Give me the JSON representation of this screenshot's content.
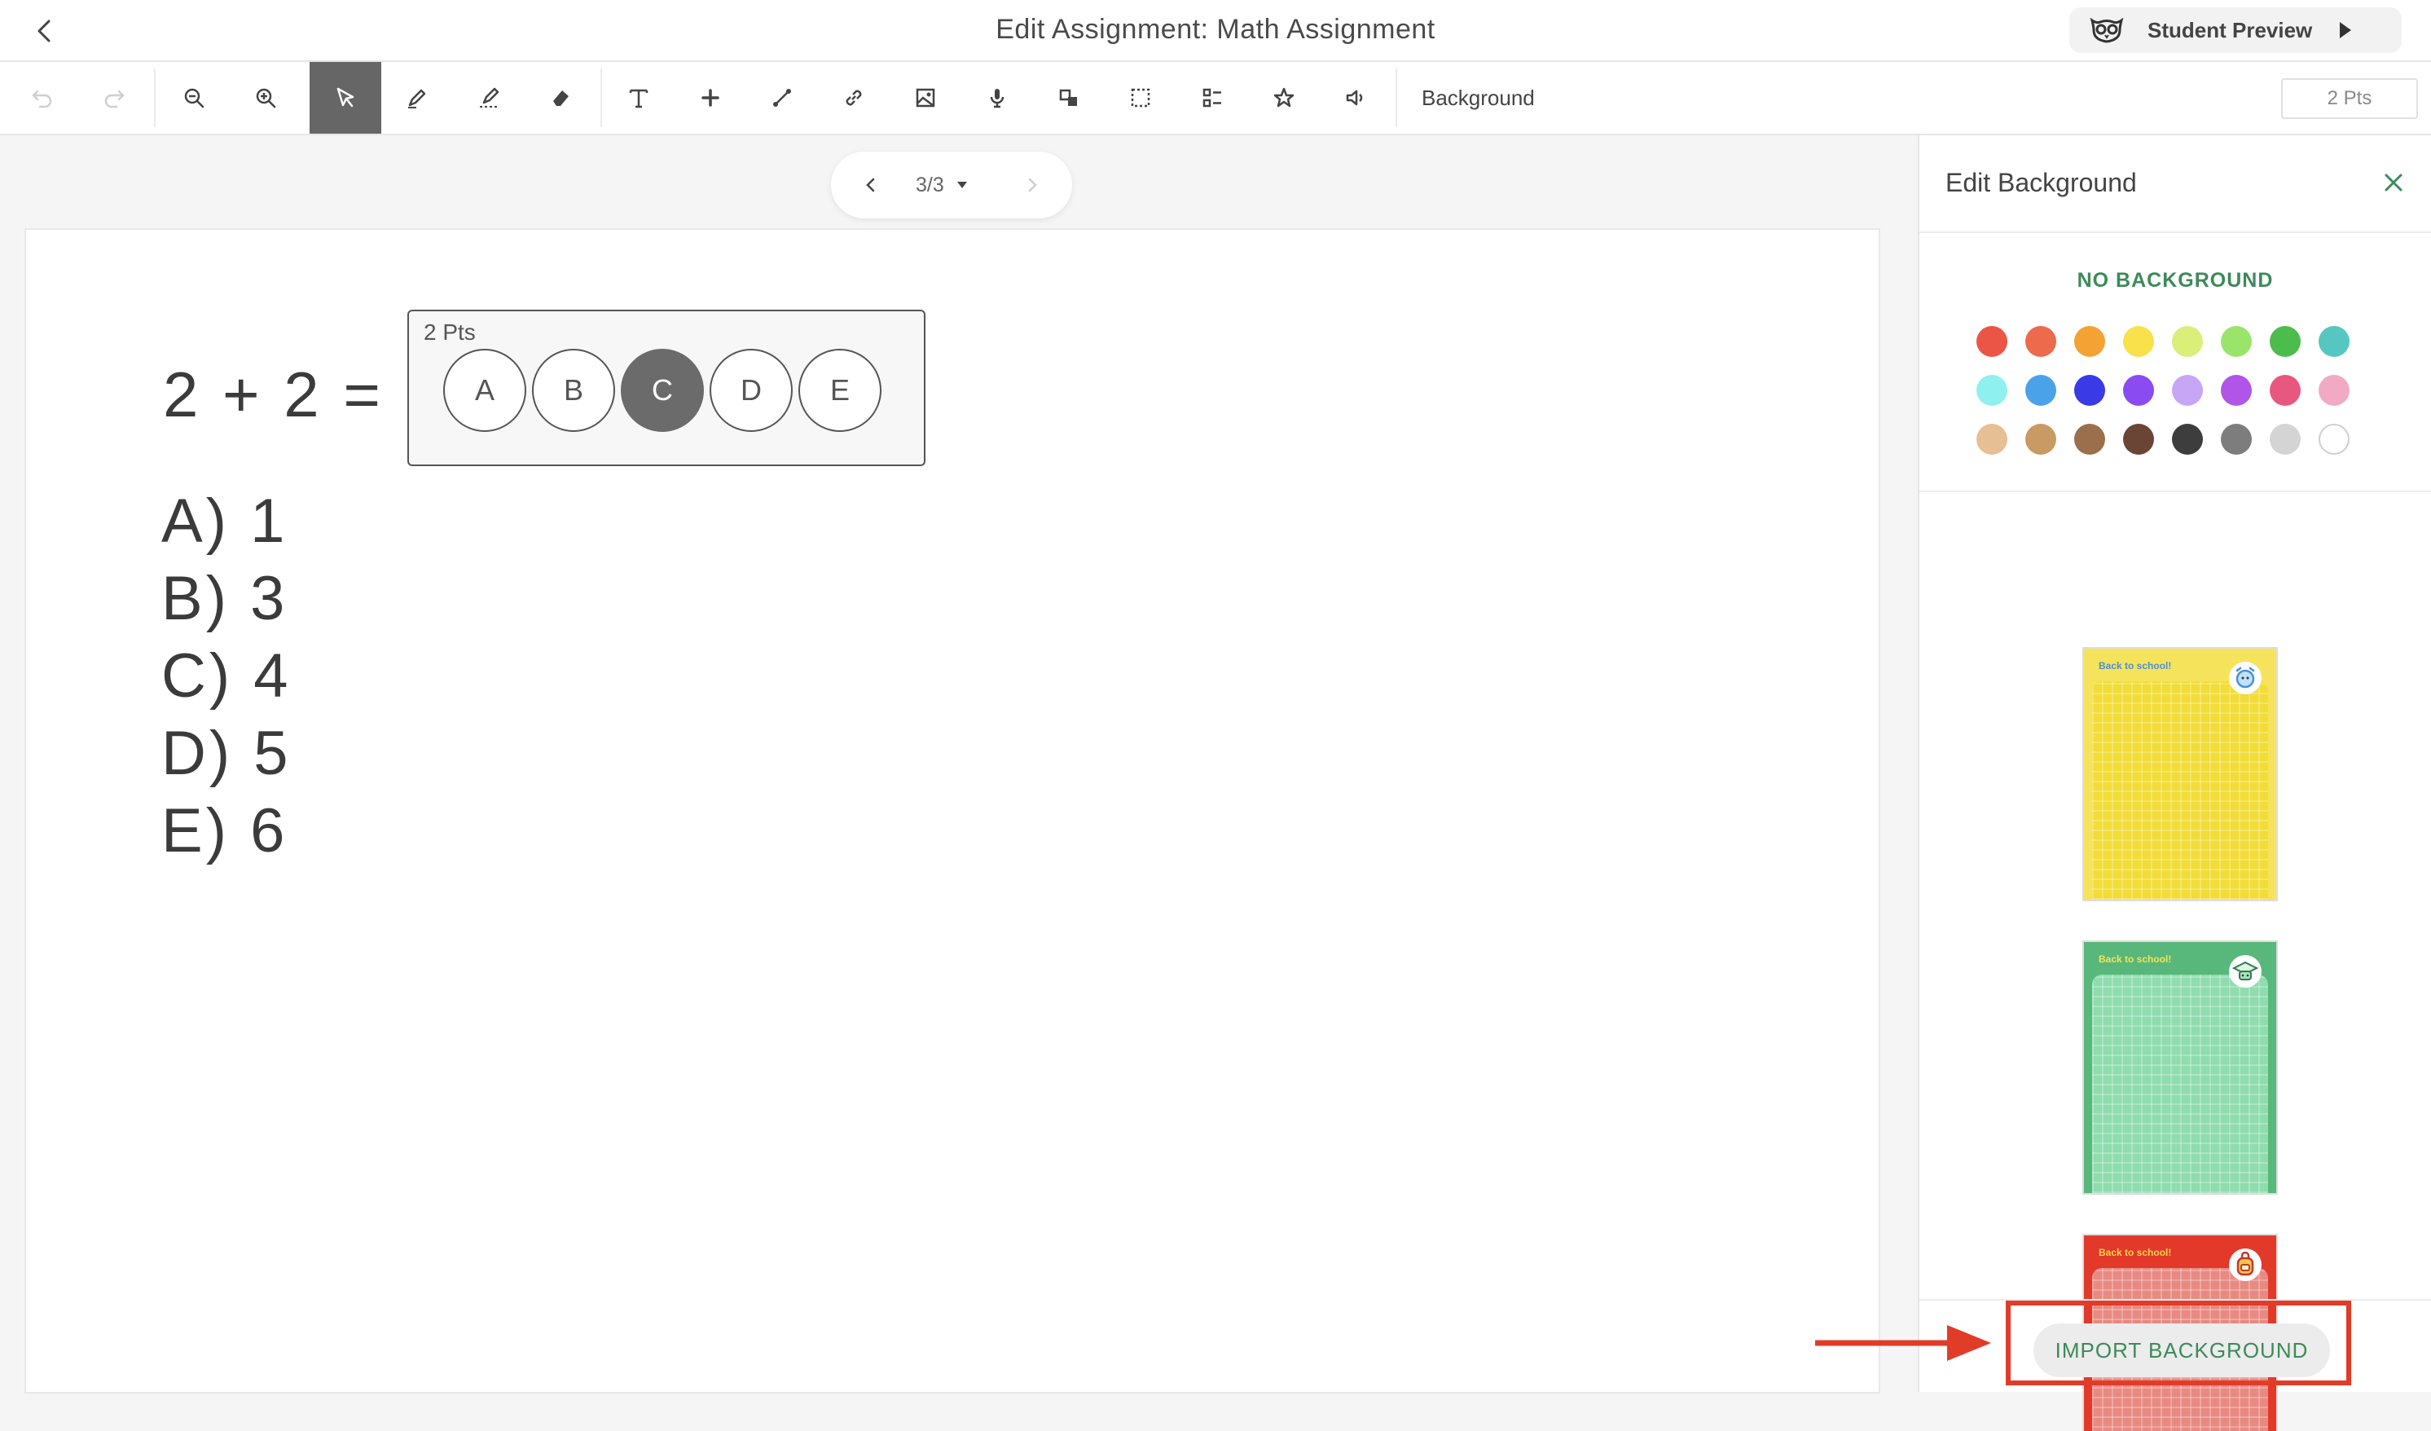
{
  "header": {
    "title": "Edit Assignment: Math Assignment",
    "student_preview_label": "Student Preview"
  },
  "toolbar": {
    "tools": [
      "undo-icon",
      "redo-icon",
      "zoom-out-icon",
      "zoom-in-icon",
      "select-icon",
      "pen-icon",
      "highlighter-icon",
      "eraser-icon",
      "text-icon",
      "plus-icon",
      "line-icon",
      "link-icon",
      "image-icon",
      "microphone-icon",
      "shapes-icon",
      "marquee-icon",
      "answer-bubble-icon",
      "star-icon",
      "speaker-icon"
    ],
    "active_tool": "select-icon",
    "background_label": "Background",
    "points_value": "2 Pts"
  },
  "pager": {
    "current": "3/3"
  },
  "worksheet": {
    "equation": "2 + 2 =",
    "answer_box": {
      "points": "2 Pts",
      "choices": [
        "A",
        "B",
        "C",
        "D",
        "E"
      ],
      "selected": "C"
    },
    "options": [
      "A) 1",
      "B) 3",
      "C) 4",
      "D) 5",
      "E) 6"
    ]
  },
  "panel": {
    "title": "Edit Background",
    "no_background_label": "NO BACKGROUND",
    "swatch_colors": [
      [
        "#eb5546",
        "#ed6a4c",
        "#f4a233",
        "#f8e14a",
        "#d9ef7a",
        "#9be46c",
        "#4cbd4c",
        "#55c6c0"
      ],
      [
        "#8ef0ef",
        "#4aa3e8",
        "#3a3ae6",
        "#8a4cf0",
        "#c7a6f5",
        "#b055e8",
        "#e8577f",
        "#f2a9c4"
      ],
      [
        "#e6bf94",
        "#c99a63",
        "#9b6f4b",
        "#6a4535",
        "#3d3d3d",
        "#7d7d7d",
        "#d4d4d4",
        "#ffffff"
      ]
    ],
    "templates": [
      {
        "text": "Back to school!",
        "bg": "#f6e35c",
        "sheet": "#f2dc38",
        "text_color": "#4a8fd8"
      },
      {
        "text": "Back to school!",
        "bg": "#58b77a",
        "sheet": "#8fdcae",
        "text_color": "#f4e35a"
      },
      {
        "text": "Back to school!",
        "bg": "#e2392a",
        "sheet": "#e88a82",
        "text_color": "#f6d44a"
      }
    ],
    "import_label": "IMPORT BACKGROUND"
  }
}
